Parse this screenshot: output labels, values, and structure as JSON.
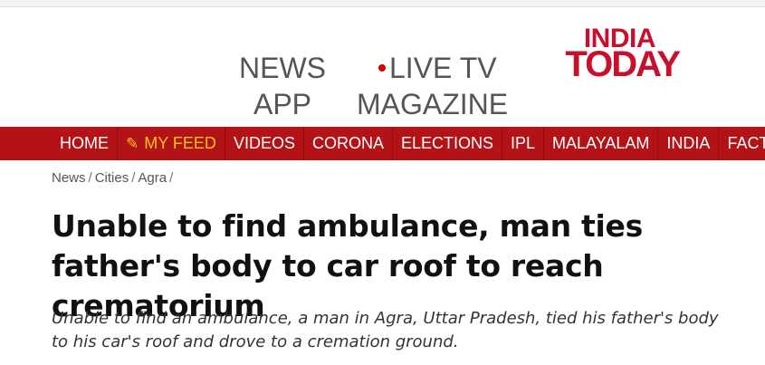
{
  "header": {
    "news_app": [
      "NEWS",
      "APP"
    ],
    "live_tv": "LIVE TV",
    "magazine": "MAGAZINE",
    "logo": [
      "INDIA",
      "TODAY"
    ]
  },
  "nav": {
    "items": [
      {
        "label": "HOME"
      },
      {
        "label": "MY FEED"
      },
      {
        "label": "VIDEOS"
      },
      {
        "label": "CORONA"
      },
      {
        "label": "ELECTIONS"
      },
      {
        "label": "IPL"
      },
      {
        "label": "MALAYALAM"
      },
      {
        "label": "INDIA"
      },
      {
        "label": "FACT CHE"
      }
    ]
  },
  "breadcrumb": {
    "items": [
      "News",
      "Cities",
      "Agra"
    ],
    "separator": "/"
  },
  "article": {
    "headline": "Unable to find ambulance, man ties father's body to car roof to reach crematorium",
    "summary": "Unable to find an ambulance, a man in Agra, Uttar Pradesh, tied his father's body to his car's roof and drove to a cremation ground."
  },
  "colors": {
    "nav_bg": "#b31217",
    "brand_red": "#c8102e",
    "myfeed_accent": "#f5c518"
  }
}
